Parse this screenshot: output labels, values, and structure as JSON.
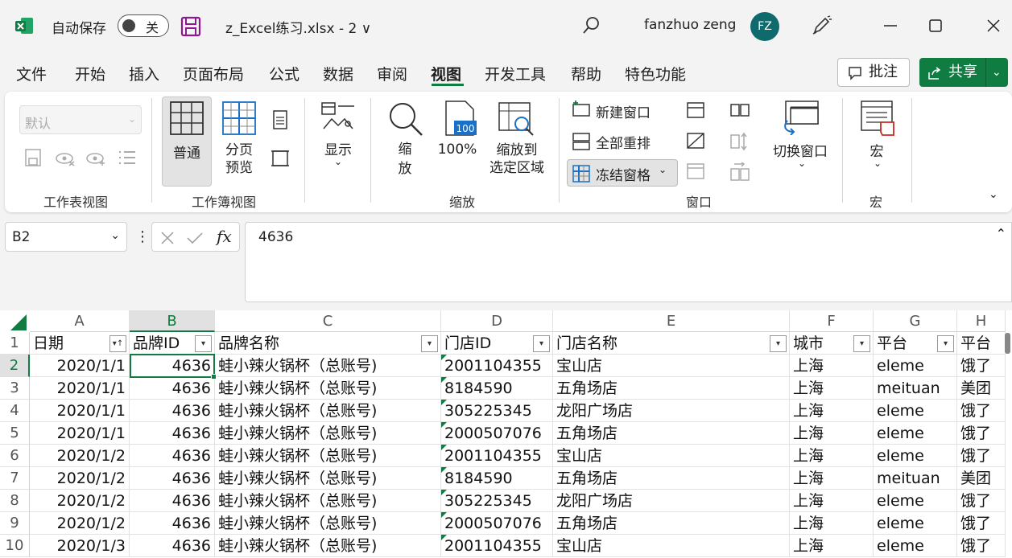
{
  "titlebar": {
    "autosave_label": "自动保存",
    "autosave_state": "关",
    "filename": "z_Excel练习.xlsx  -  2 ∨",
    "username": "fanzhuo zeng",
    "avatar_initials": "FZ"
  },
  "menu": {
    "items": [
      "文件",
      "开始",
      "插入",
      "页面布局",
      "公式",
      "数据",
      "审阅",
      "视图",
      "开发工具",
      "帮助",
      "特色功能"
    ],
    "active": "视图",
    "comment_label": "批注",
    "share_label": "共享"
  },
  "ribbon": {
    "sheet_view": {
      "select_value": "默认",
      "group_label": "工作表视图"
    },
    "workbook_views": {
      "normal": "普通",
      "page_break": "分页\n预览",
      "group_label": "工作簿视图"
    },
    "show": {
      "label": "显示"
    },
    "zoom": {
      "zoom": "缩\n放",
      "hundred": "100%",
      "zoom_selection": "缩放到\n选定区域",
      "group_label": "缩放"
    },
    "window": {
      "new_window": "新建窗口",
      "arrange_all": "全部重排",
      "freeze_panes": "冻结窗格",
      "switch_windows": "切换窗口",
      "group_label": "窗口"
    },
    "macros": {
      "label": "宏",
      "group_label": "宏"
    }
  },
  "formula_bar": {
    "name_box": "B2",
    "formula": "4636"
  },
  "sheet": {
    "columns": [
      "A",
      "B",
      "C",
      "D",
      "E",
      "F",
      "G",
      "H"
    ],
    "selected_column": "B",
    "selected_row": "2",
    "header_row": [
      "日期",
      "品牌ID",
      "品牌名称",
      "门店ID",
      "门店名称",
      "城市",
      "平台",
      "平台"
    ],
    "rows": [
      {
        "n": "1"
      },
      {
        "n": "2",
        "cells": [
          "2020/1/1",
          "4636",
          "蛙小辣火锅杯（总账号)",
          "2001104355",
          "宝山店",
          "上海",
          "eleme",
          "饿了"
        ]
      },
      {
        "n": "3",
        "cells": [
          "2020/1/1",
          "4636",
          "蛙小辣火锅杯（总账号)",
          "8184590",
          "五角场店",
          "上海",
          "meituan",
          "美团"
        ]
      },
      {
        "n": "4",
        "cells": [
          "2020/1/1",
          "4636",
          "蛙小辣火锅杯（总账号)",
          "305225345",
          "龙阳广场店",
          "上海",
          "eleme",
          "饿了"
        ]
      },
      {
        "n": "5",
        "cells": [
          "2020/1/1",
          "4636",
          "蛙小辣火锅杯（总账号)",
          "2000507076",
          "五角场店",
          "上海",
          "eleme",
          "饿了"
        ]
      },
      {
        "n": "6",
        "cells": [
          "2020/1/2",
          "4636",
          "蛙小辣火锅杯（总账号)",
          "2001104355",
          "宝山店",
          "上海",
          "eleme",
          "饿了"
        ]
      },
      {
        "n": "7",
        "cells": [
          "2020/1/2",
          "4636",
          "蛙小辣火锅杯（总账号)",
          "8184590",
          "五角场店",
          "上海",
          "meituan",
          "美团"
        ]
      },
      {
        "n": "8",
        "cells": [
          "2020/1/2",
          "4636",
          "蛙小辣火锅杯（总账号)",
          "305225345",
          "龙阳广场店",
          "上海",
          "eleme",
          "饿了"
        ]
      },
      {
        "n": "9",
        "cells": [
          "2020/1/2",
          "4636",
          "蛙小辣火锅杯（总账号)",
          "2000507076",
          "五角场店",
          "上海",
          "eleme",
          "饿了"
        ]
      },
      {
        "n": "10",
        "cells": [
          "2020/1/3",
          "4636",
          "蛙小辣火锅杯（总账号)",
          "2001104355",
          "宝山店",
          "上海",
          "eleme",
          "饿了"
        ]
      }
    ]
  },
  "colors": {
    "accent": "#107c41",
    "avatar_bg": "#0e6a6c"
  }
}
